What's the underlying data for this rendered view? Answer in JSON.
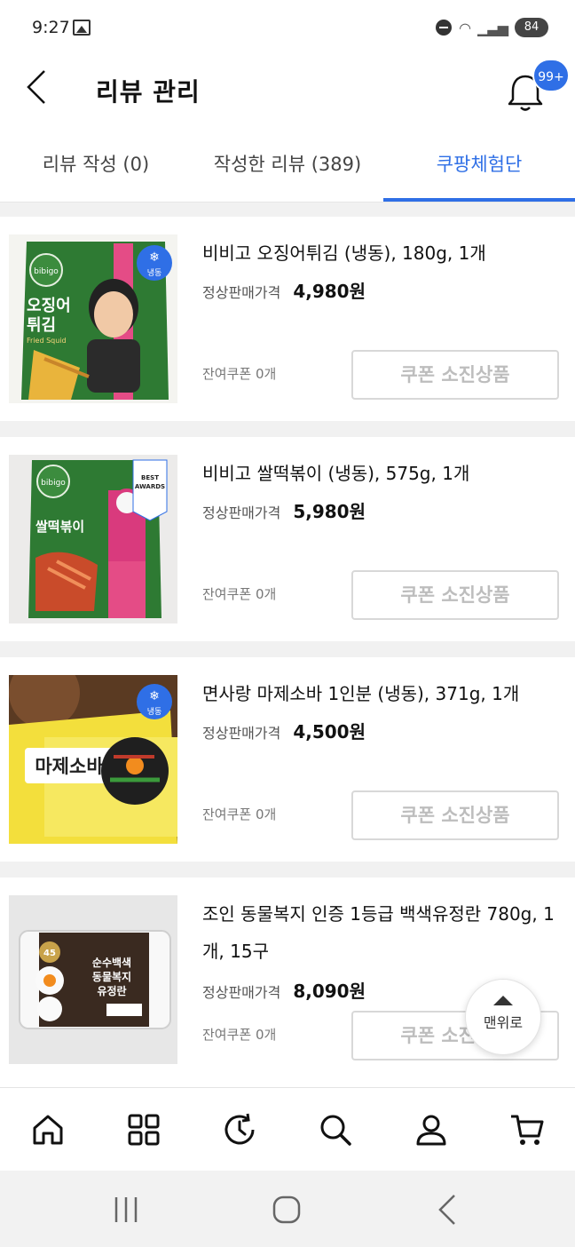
{
  "status_bar": {
    "time": "9:27",
    "battery": "84"
  },
  "header": {
    "title": "리뷰 관리",
    "notification_badge": "99+"
  },
  "tabs": [
    {
      "label": "리뷰 작성 (0)"
    },
    {
      "label": "작성한 리뷰 (389)"
    },
    {
      "label": "쿠팡체험단",
      "active": true
    }
  ],
  "products": [
    {
      "name": "비비고 오징어튀김 (냉동), 180g, 1개",
      "price_label": "정상판매가격",
      "price": "4,980원",
      "coupons_left": "잔여쿠폰 0개",
      "button": "쿠폰 소진상품"
    },
    {
      "name": "비비고 쌀떡볶이 (냉동), 575g, 1개",
      "price_label": "정상판매가격",
      "price": "5,980원",
      "coupons_left": "잔여쿠폰 0개",
      "button": "쿠폰 소진상품"
    },
    {
      "name": "면사랑 마제소바 1인분 (냉동), 371g, 1개",
      "price_label": "정상판매가격",
      "price": "4,500원",
      "coupons_left": "잔여쿠폰 0개",
      "button": "쿠폰 소진상품"
    },
    {
      "name": "조인 동물복지 인증 1등급 백색유정란 780g, 1개, 15구",
      "price_label": "정상판매가격",
      "price": "8,090원",
      "coupons_left": "잔여쿠폰 0개",
      "button": "쿠폰 소진상품"
    }
  ],
  "product_images": {
    "p1_brand": "bibigo",
    "p1_line1": "오징어",
    "p1_line2": "튀김",
    "p1_sub": "Fried Squid",
    "p1_badge": "냉동",
    "p2_brand": "bibigo",
    "p2_line1": "쌀떡볶이",
    "p2_award1": "BEST",
    "p2_award2": "AWARDS",
    "p3_title": "마제소바",
    "p3_badge": "냉동",
    "p4_line1": "순수백색",
    "p4_line2": "동물복지",
    "p4_line3": "유정란",
    "p4_num": "45"
  },
  "scroll_top": {
    "label": "맨위로"
  },
  "bottom_nav": [
    "home-icon",
    "category-icon",
    "recent-icon",
    "search-icon",
    "user-icon",
    "cart-icon"
  ],
  "colors": {
    "accent": "#2f6fe6",
    "disabled_text": "#bdbdbd"
  }
}
